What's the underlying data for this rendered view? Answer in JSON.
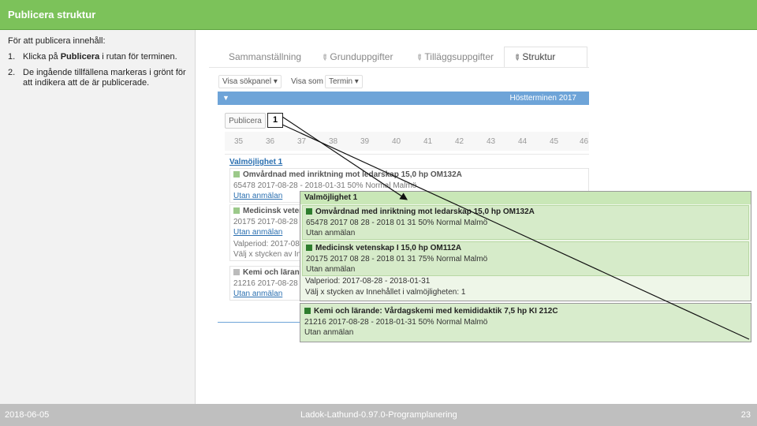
{
  "header": {
    "title": "Publicera struktur"
  },
  "instructions": {
    "intro": "För att publicera innehåll:",
    "steps": [
      {
        "num": "1.",
        "before": "Klicka på ",
        "bold": "Publicera",
        "after": " i rutan för terminen."
      },
      {
        "num": "2.",
        "before": "De ingående tillfällena markeras i grönt för att indikera att de är publicerade.",
        "bold": "",
        "after": ""
      }
    ]
  },
  "screenshot": {
    "tabs": [
      "Sammanställning",
      "Grunduppgifter",
      "Tilläggsuppgifter",
      "Struktur"
    ],
    "active_tab": "Struktur",
    "controls": {
      "view_panel": "Visa sökpanel",
      "view_as_label": "Visa som",
      "view_as_value": "Termin"
    },
    "term": "Höstterminen 2017",
    "publish_button": "Publicera",
    "weeks": [
      "35",
      "36",
      "37",
      "38",
      "39",
      "40",
      "41",
      "42",
      "43",
      "44",
      "45",
      "46"
    ],
    "option_link": "Valmöjlighet 1",
    "small_rows": [
      {
        "l1": "Omvårdnad med inriktning mot ledarskap 15,0 hp OM132A",
        "l2": "65478 2017-08-28 - 2018-01-31 50% Normal Malmö",
        "l3": "Utan anmälan"
      },
      {
        "l1": "Medicinsk vetenskap I 15,0 hp OM112A",
        "l2": "20175 2017-08-28 - 2018-01-31 75% Normal Malmö",
        "l3": "Utan anmälan",
        "l4": "Valperiod: 2017-08-28 - 2018-01-31",
        "l5": "Välj x stycken av Innehållet i valmöjligheten: 1"
      },
      {
        "l1": "Kemi och lärande: Vårdagskemi med kemididaktik 7,5 hp KI 212C",
        "l2": "21216 2017-08-28 - 2018-01-31 50% Normal Malmö",
        "l3": "Utan anmälan"
      }
    ]
  },
  "callout": "1",
  "zoom": {
    "title": "Valmöjlighet 1",
    "course1": {
      "name": "Omvårdnad med inriktning mot ledarskap 15,0 hp OM132A",
      "details": "65478 2017 08 28 - 2018 01 31 50% Normal Malmö",
      "status": "Utan anmälan"
    },
    "course2": {
      "name": "Medicinsk vetenskap I 15,0 hp OM112A",
      "details": "20175 2017 08 28 - 2018 01 31 75% Normal Malmö",
      "status": "Utan anmälan"
    },
    "period": "Valperiod: 2017-08-28 - 2018-01-31",
    "choose": "Välj x stycken av Innehållet i valmöjligheten: 1",
    "course3": {
      "name": "Kemi och lärande: Vårdagskemi med kemididaktik 7,5 hp KI 212C",
      "details": "21216 2017-08-28 - 2018-01-31 50% Normal Malmö",
      "status": "Utan anmälan"
    }
  },
  "footer": {
    "date": "2018-06-05",
    "center": "Ladok-Lathund-0.97.0-Programplanering",
    "page": "23"
  },
  "colors": {
    "header_green": "#7cc25a",
    "published_green": "#d6ebc9",
    "term_blue": "#6ea4d8"
  }
}
